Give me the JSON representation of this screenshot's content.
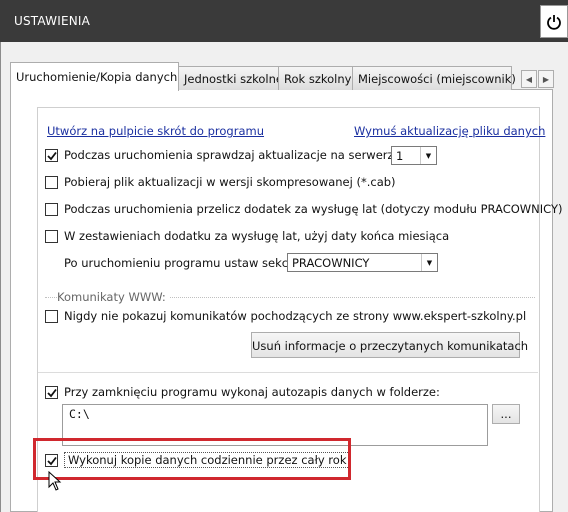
{
  "window": {
    "title": "USTAWIENIA",
    "power_icon": "power-icon"
  },
  "tabs": [
    {
      "label": "Uruchomienie/Kopia danych",
      "active": true
    },
    {
      "label": "Jednostki szkolne",
      "active": false
    },
    {
      "label": "Rok szkolny",
      "active": false
    },
    {
      "label": "Miejscowości (miejscownik)",
      "active": false
    }
  ],
  "tab_scroll": {
    "left": "◀",
    "right": "▶"
  },
  "links": {
    "shortcut": "Utwórz na pulpicie skrót do programu",
    "force_update": "Wymuś aktualizację pliku danych"
  },
  "options": {
    "check_updates": {
      "label": "Podczas uruchomienia sprawdzaj aktualizacje na serwerze nr:",
      "checked": true
    },
    "server_select": {
      "value": "1"
    },
    "compressed": {
      "label": "Pobieraj plik aktualizacji w wersji skompresowanej (*.cab)",
      "checked": false
    },
    "recalc_bonus": {
      "label": "Podczas uruchomienia przelicz dodatek za wysługę lat (dotyczy modułu PRACOWNICY)",
      "checked": false
    },
    "month_end": {
      "label": "W zestawieniach dodatku za wysługę lat, użyj daty końca miesiąca",
      "checked": false
    },
    "section_label": "Po uruchomieniu programu ustaw sekcję:",
    "section_select": {
      "value": "PRACOWNICY"
    }
  },
  "www": {
    "group_label": "Komunikaty WWW:",
    "never_show": {
      "label": "Nigdy nie pokazuj komunikatów pochodzących ze strony www.ekspert-szkolny.pl",
      "checked": false
    },
    "remove_button": "Usuń informacje o przeczytanych komunikatach"
  },
  "backup": {
    "autosave": {
      "label": "Przy zamknięciu programu wykonaj autozapis danych w folderze:",
      "checked": true
    },
    "folder_path": "C:\\",
    "browse_button": "...",
    "daily_copy": {
      "label": "Wykonuj kopie danych codziennie przez cały rok",
      "checked": true
    }
  },
  "colors": {
    "titlebar": "#3a3a3a",
    "link": "#1a2fa0",
    "highlight": "#d0282e"
  }
}
